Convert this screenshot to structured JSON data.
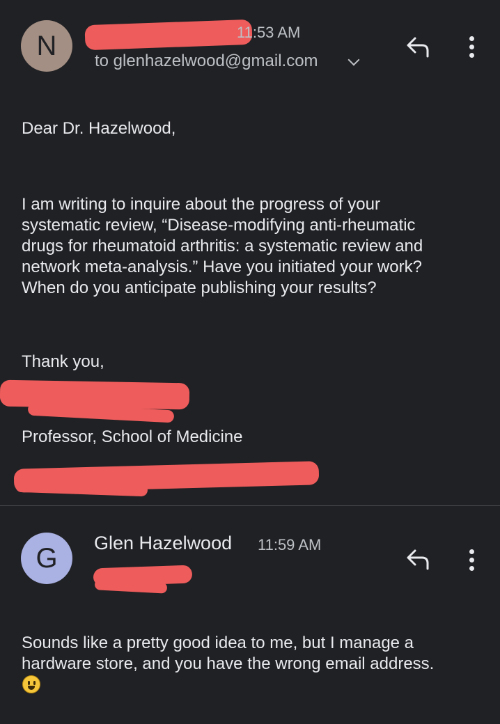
{
  "thread": {
    "first_message": {
      "avatar_letter": "N",
      "time": "11:53 AM",
      "recipient": "to glenhazelwood@gmail.com",
      "body": {
        "salutation": "Dear Dr. Hazelwood,",
        "paragraph_lines": [
          "I am writing to inquire about the progress of your",
          "systematic review, “Disease-modifying anti-rheumatic",
          "drugs for rheumatoid arthritis: a systematic review and",
          "network meta-analysis.”  Have you initiated your work?",
          "When do you anticipate publishing your results?"
        ],
        "closing": "Thank you,",
        "signature_title": "Professor, School of Medicine"
      }
    },
    "second_message": {
      "avatar_letter": "G",
      "sender": "Glen Hazelwood",
      "time": "11:59 AM",
      "body_lines": [
        "Sounds like a pretty good idea to me, but I manage a",
        "hardware store, and you have the wrong email address."
      ]
    }
  },
  "icons": {
    "reply": "reply-icon",
    "more": "more-vert-icon",
    "expand": "chevron-down-icon",
    "emoji": "grinning-face-emoji"
  },
  "colors": {
    "background": "#202124",
    "avatar_n": "#a48f84",
    "avatar_g": "#aab1e3",
    "redaction": "#ee5c5c"
  }
}
